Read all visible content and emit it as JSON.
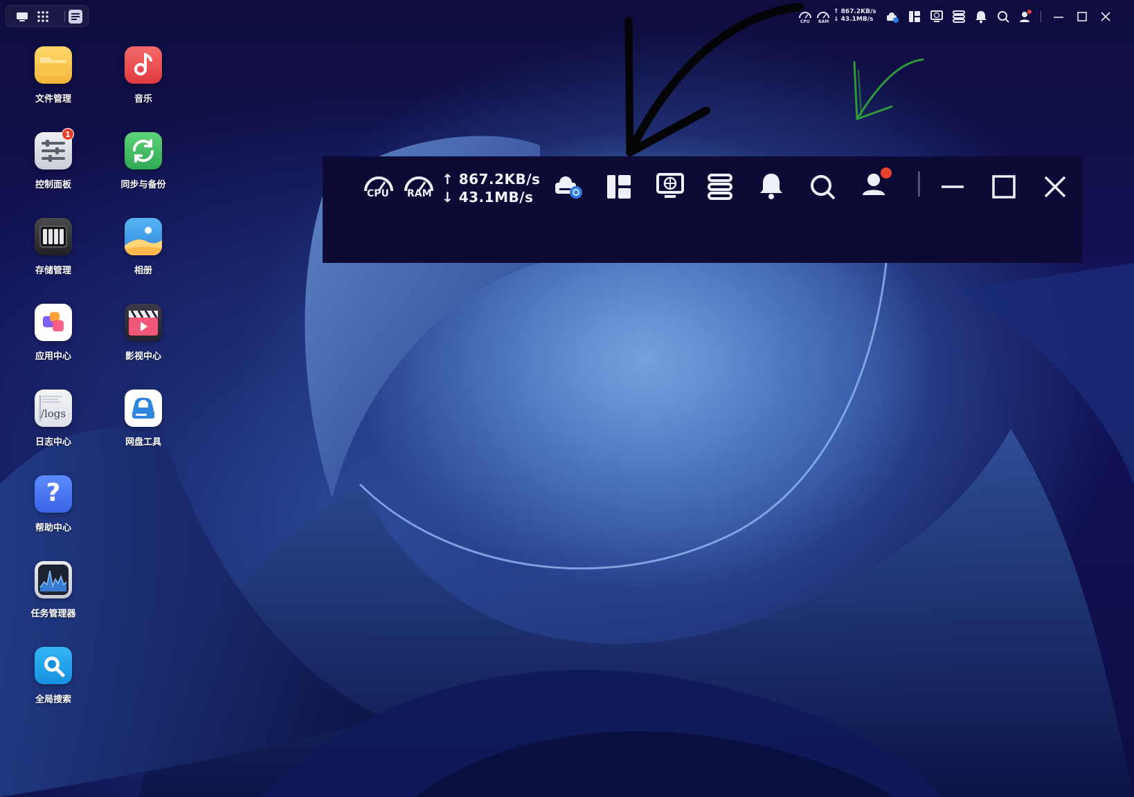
{
  "switcher": {
    "buttons": [
      "show-desktop-icon",
      "app-launcher-icon",
      "widget-panel-icon"
    ]
  },
  "tray": {
    "cpu_label": "CPU",
    "ram_label": "RAM",
    "upload_rate": "↑ 867.2KB/s",
    "download_rate": "↓ 43.1MB/s",
    "icons": [
      "cloud-drive-sync-icon",
      "layout-icon",
      "remote-desktop-icon",
      "storage-icon",
      "bell-icon",
      "search-icon",
      "user-icon",
      "minimize-icon",
      "maximize-icon",
      "close-icon"
    ],
    "notification_dot_color": "#e8412d"
  },
  "tray_zoom": {
    "cpu_label": "CPU",
    "ram_label": "RAM",
    "upload_rate": "↑ 867.2KB/s",
    "download_rate": "↓ 43.1MB/s"
  },
  "apps": [
    {
      "label": "文件管理",
      "icon": "folder-icon"
    },
    {
      "label": "音乐",
      "icon": "music-icon"
    },
    {
      "label": "控制面板",
      "icon": "control-panel-icon",
      "badge": "1"
    },
    {
      "label": "同步与备份",
      "icon": "sync-icon"
    },
    {
      "label": "存储管理",
      "icon": "storage-manager-icon"
    },
    {
      "label": "相册",
      "icon": "photos-icon"
    },
    {
      "label": "应用中心",
      "icon": "app-center-icon"
    },
    {
      "label": "影视中心",
      "icon": "video-center-icon"
    },
    {
      "label": "日志中心",
      "icon": "logs-icon",
      "tile_text": "/logs"
    },
    {
      "label": "网盘工具",
      "icon": "cloud-disk-icon"
    },
    {
      "label": "帮助中心",
      "icon": "help-icon",
      "tile_text": "?"
    },
    {
      "label": "任务管理器",
      "icon": "task-manager-icon"
    },
    {
      "label": "全局搜索",
      "icon": "global-search-icon"
    }
  ],
  "colors": {
    "wallpaper_dark": "#0f0d3e",
    "wallpaper_blue": "#3d63b3",
    "accent_red": "#e8412d",
    "arrow_green": "#2f9a3a"
  }
}
